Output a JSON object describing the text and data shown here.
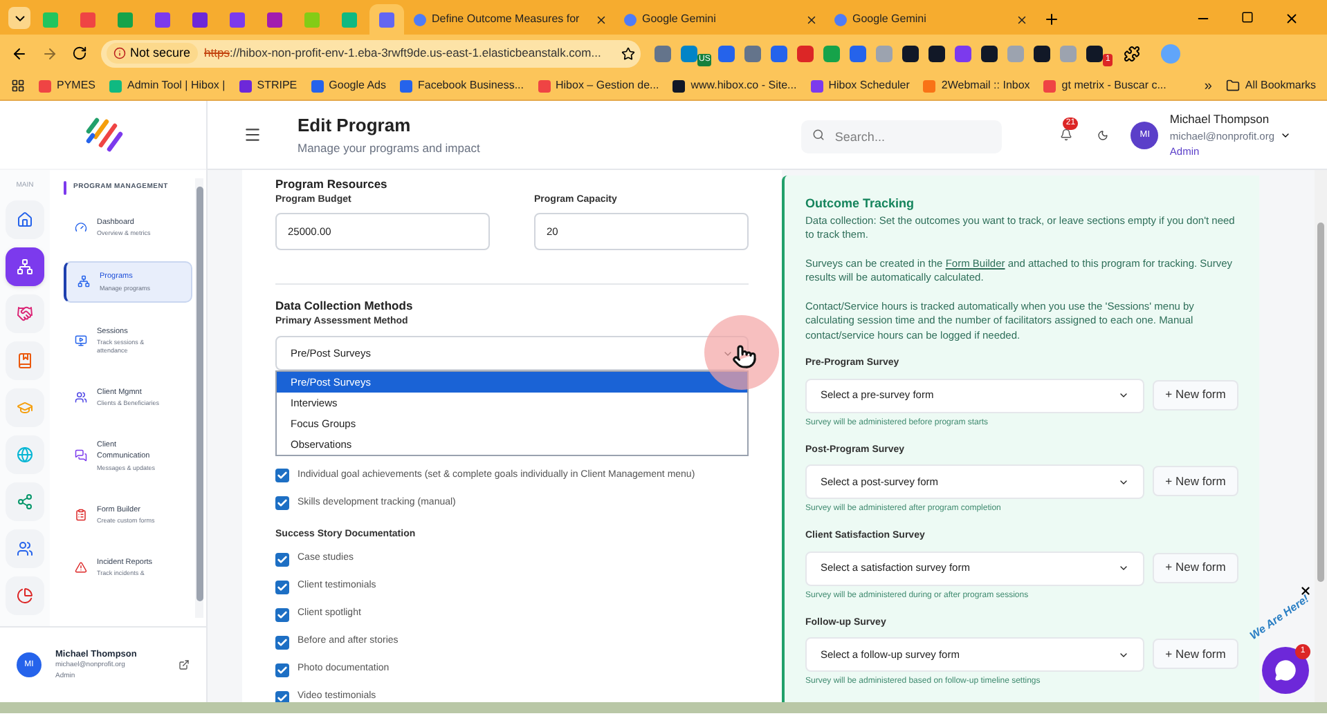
{
  "browser": {
    "pinned_tabs": [
      {
        "selected": false
      },
      {
        "selected": false
      },
      {
        "selected": false
      },
      {
        "selected": false
      },
      {
        "selected": false
      },
      {
        "selected": false
      },
      {
        "selected": false
      },
      {
        "selected": false
      },
      {
        "selected": false
      },
      {
        "selected": true
      }
    ],
    "tabs": [
      {
        "title": "Define Outcome Measures for",
        "selected": false
      },
      {
        "title": "Google Gemini",
        "selected": false
      },
      {
        "title": "Google Gemini",
        "selected": false
      }
    ],
    "address": {
      "security": "Not secure",
      "scheme": "https",
      "rest": "://hibox-non-profit-env-1.eba-3rwft9de.us-east-1.elasticbeanstalk.com..."
    },
    "extension_badges": [
      "US",
      "1"
    ],
    "bookmarks": [
      "PYMES",
      "Admin Tool | Hibox |",
      "STRIPE",
      "Google Ads",
      "Facebook Business...",
      "Hibox – Gestion de...",
      "www.hibox.co - Site...",
      "Hibox Scheduler",
      "2Webmail :: Inbox",
      "gt metrix - Buscar c..."
    ],
    "more": "»",
    "all_bookmarks": "All Bookmarks"
  },
  "rail": {
    "label": "MAIN",
    "items": [
      {
        "selected": false
      },
      {
        "selected": true
      },
      {
        "selected": false
      },
      {
        "selected": false
      },
      {
        "selected": false
      },
      {
        "selected": false
      },
      {
        "selected": false
      },
      {
        "selected": false
      },
      {
        "selected": false
      }
    ]
  },
  "menu": {
    "title": "PROGRAM MANAGEMENT",
    "items": [
      {
        "label": "Dashboard",
        "subtitle": "Overview & metrics",
        "selected": false
      },
      {
        "label": "Programs",
        "subtitle": "Manage programs",
        "selected": true
      },
      {
        "label": "Sessions",
        "subtitle": "Track sessions & attendance",
        "selected": false
      },
      {
        "label": "Client Mgmnt",
        "subtitle": "Clients & Beneficiaries",
        "selected": false
      },
      {
        "label": "Client Communication",
        "subtitle": "Messages & updates",
        "selected": false
      },
      {
        "label": "Form Builder",
        "subtitle": "Create custom forms",
        "selected": false
      },
      {
        "label": "Incident Reports",
        "subtitle": "Track incidents &",
        "selected": false
      }
    ]
  },
  "sidebar_user": {
    "initials": "MI",
    "name": "Michael Thompson",
    "email": "michael@nonprofit.org",
    "role": "Admin"
  },
  "header": {
    "title": "Edit Program",
    "subtitle": "Manage your programs and impact",
    "search_placeholder": "Search...",
    "notifications": "21",
    "user": {
      "initials": "MI",
      "name": "Michael Thompson",
      "email": "michael@nonprofit.org",
      "role": "Admin"
    }
  },
  "resources": {
    "title": "Program Resources",
    "fields": [
      {
        "label": "Program Budget",
        "value": "25000.00"
      },
      {
        "label": "Program Capacity",
        "value": "20"
      }
    ]
  },
  "data_collection": {
    "title": "Data Collection Methods",
    "label": "Primary Assessment Method",
    "value": "Pre/Post Surveys",
    "options": [
      {
        "label": "Pre/Post Surveys",
        "selected": true
      },
      {
        "label": "Interviews",
        "selected": false
      },
      {
        "label": "Focus Groups",
        "selected": false
      },
      {
        "label": "Observations",
        "selected": false
      }
    ],
    "checks": [
      {
        "label": "Individual goal achievements (set & complete goals individually in Client Management menu)",
        "checked": true
      },
      {
        "label": "Skills development tracking (manual)",
        "checked": true
      }
    ]
  },
  "success_stories": {
    "title": "Success Story Documentation",
    "items": [
      {
        "label": "Case studies",
        "checked": true
      },
      {
        "label": "Client testimonials",
        "checked": true
      },
      {
        "label": "Client spotlight",
        "checked": true
      },
      {
        "label": "Before and after stories",
        "checked": true
      },
      {
        "label": "Photo documentation",
        "checked": true
      },
      {
        "label": "Video testimonials",
        "checked": true
      }
    ]
  },
  "outcome": {
    "title": "Outcome Tracking",
    "intro": "Data collection: Set the outcomes you want to track, or leave sections empty if you don't need to track them.",
    "surveys_text": {
      "before": "Surveys can be created in the",
      "link": "Form Builder",
      "after": "and attached to this program for tracking. Survey results will be automatically calculated."
    },
    "hours_text": "Contact/Service hours is tracked automatically when you use the 'Sessions' menu by calculating session time and the number of facilitators assigned to each one. Manual contact/service hours can be logged if needed.",
    "surveys": [
      {
        "label": "Pre-Program Survey",
        "placeholder": "Select a pre-survey form",
        "hint": "Survey will be administered before program starts",
        "button": "+ New form"
      },
      {
        "label": "Post-Program Survey",
        "placeholder": "Select a post-survey form",
        "hint": "Survey will be administered after program completion",
        "button": "+ New form"
      },
      {
        "label": "Client Satisfaction Survey",
        "placeholder": "Select a satisfaction survey form",
        "hint": "Survey will be administered during or after program sessions",
        "button": "+ New form"
      },
      {
        "label": "Follow-up Survey",
        "placeholder": "Select a follow-up survey form",
        "hint": "Survey will be administered based on follow-up timeline settings",
        "button": "+ New form"
      }
    ]
  },
  "chat": {
    "text": "We Are Here!",
    "badge": "1"
  }
}
